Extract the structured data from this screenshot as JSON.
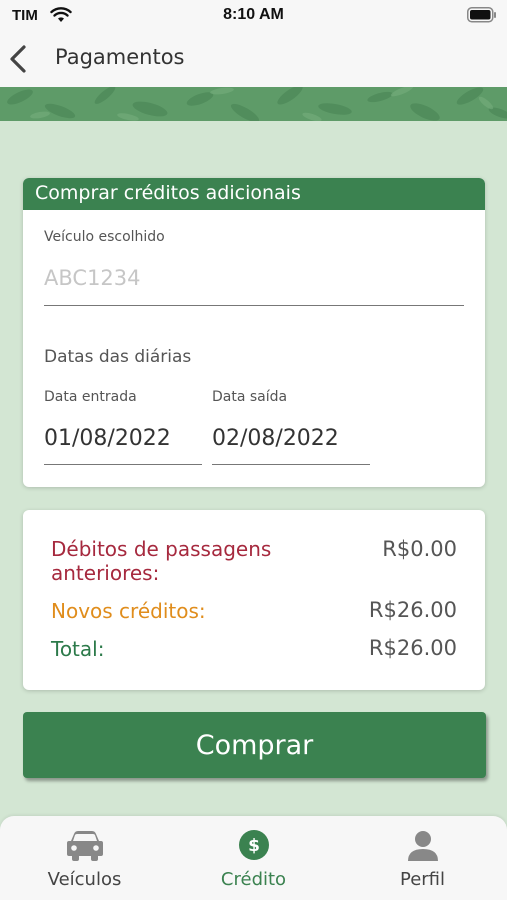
{
  "status_bar": {
    "carrier": "TIM",
    "time": "8:10 AM"
  },
  "nav": {
    "title": "Pagamentos"
  },
  "purchase": {
    "header": "Comprar créditos adicionais",
    "vehicle_label": "Veículo escolhido",
    "vehicle_placeholder": "ABC1234",
    "dates_title": "Datas das diárias",
    "entry_label": "Data entrada",
    "entry_value": "01/08/2022",
    "exit_label": "Data saída",
    "exit_value": "02/08/2022"
  },
  "summary": {
    "debt_label_line1": "Débitos de passagens",
    "debt_label_line2": "anteriores:",
    "debt_value": "R$0.00",
    "new_label": "Novos créditos:",
    "new_value": "R$26.00",
    "total_label": "Total:",
    "total_value": "R$26.00"
  },
  "buy_button": {
    "label": "Comprar"
  },
  "tabs": [
    {
      "label": "Veículos",
      "icon": "car-icon",
      "active": false
    },
    {
      "label": "Crédito",
      "icon": "dollar-icon",
      "active": true
    },
    {
      "label": "Perfil",
      "icon": "person-icon",
      "active": false
    }
  ],
  "colors": {
    "primary": "#3b8250",
    "background": "#d3e6d3",
    "debt": "#a6293e",
    "new_credits": "#e08d1c",
    "total": "#2c7a4a"
  }
}
